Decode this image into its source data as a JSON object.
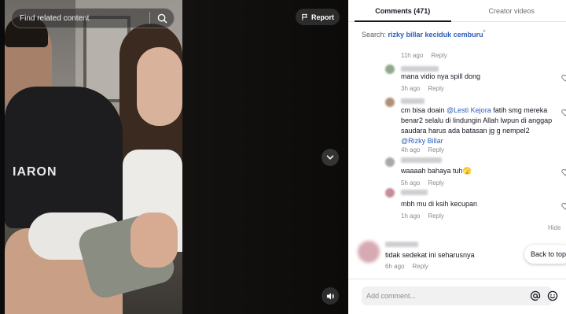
{
  "video": {
    "search_placeholder": "Find related content",
    "report_label": "Report",
    "shirt_text": "IARON"
  },
  "tabs": [
    {
      "label": "Comments (471)",
      "active": true
    },
    {
      "label": "Creator videos",
      "active": false
    }
  ],
  "search": {
    "prefix": "Search: ",
    "query": "rizky billar keciduk cemburu",
    "mark": "⁰"
  },
  "comments": [
    {
      "meta_time": "11h ago",
      "reply_label": "Reply",
      "text_parts": []
    },
    {
      "meta_time": "3h ago",
      "reply_label": "Reply",
      "text_parts": [
        "mana vidio nya spill dong"
      ]
    },
    {
      "meta_time": "4h ago",
      "reply_label": "Reply",
      "text_parts": [
        "cm bisa doain ",
        "@Lesti Kejora",
        " fatih smg mereka benar2 selalu di lindungin Allah lwpun di anggap saudara harus ada batasan jg g nempel2 ",
        "@Rizky Billar"
      ]
    },
    {
      "meta_time": "5h ago",
      "reply_label": "Reply",
      "text_parts": [
        "waaaah bahaya tuh🫣"
      ]
    },
    {
      "meta_time": "1h ago",
      "reply_label": "Reply",
      "text_parts": [
        "mbh mu di ksih kecupan"
      ]
    },
    {
      "meta_time": "6h ago",
      "reply_label": "Reply",
      "text_parts": [
        "tidak sedekat ini seharusnya"
      ]
    }
  ],
  "hide_label": "Hide",
  "back_to_top_label": "Back to top",
  "add_comment_placeholder": "Add comment...",
  "icons": {
    "search": "search-icon",
    "report": "flag-icon",
    "scroll_down": "chevron-down-icon",
    "volume": "volume-icon",
    "mention": "at-icon",
    "emoji": "emoji-icon",
    "like": "heart-icon"
  }
}
